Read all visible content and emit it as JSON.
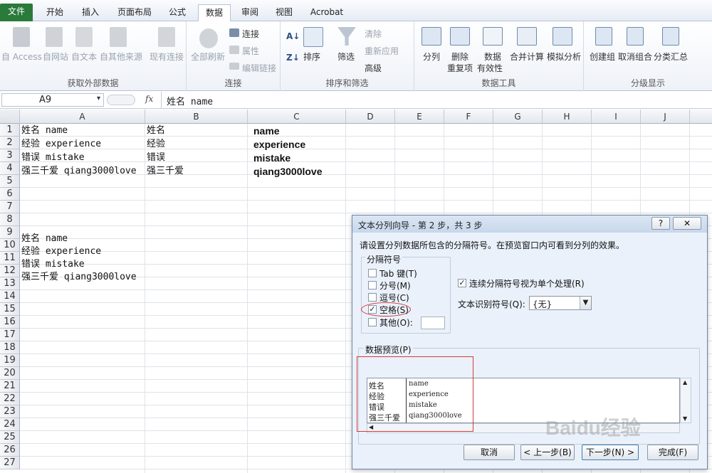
{
  "tabs": [
    "文件",
    "开始",
    "插入",
    "页面布局",
    "公式",
    "数据",
    "审阅",
    "视图",
    "Acrobat"
  ],
  "ribbon": {
    "external": {
      "label": "获取外部数据",
      "access": "自 Access",
      "web": "自网站",
      "text": "自文本",
      "other": "自其他来源",
      "existing": "现有连接"
    },
    "connections": {
      "label": "连接",
      "refresh_all": "全部刷新",
      "connections": "连接",
      "properties": "属性",
      "edit_links": "编辑链接"
    },
    "sort_filter": {
      "label": "排序和筛选",
      "sort": "排序",
      "filter": "筛选",
      "clear": "清除",
      "reapply": "重新应用",
      "advanced": "高级"
    },
    "data_tools": {
      "label": "数据工具",
      "text_to_columns": "分列",
      "remove_dup_1": "删除",
      "remove_dup_2": "重复项",
      "validation_1": "数据",
      "validation_2": "有效性",
      "consolidate": "合并计算",
      "what_if": "模拟分析"
    },
    "outline": {
      "label": "分级显示",
      "group": "创建组",
      "ungroup": "取消组合",
      "subtotal": "分类汇总"
    }
  },
  "formula_bar": {
    "name_box": "A9",
    "fx": "fx",
    "content": "姓名 name"
  },
  "sheet": {
    "columns": [
      "A",
      "B",
      "C",
      "D",
      "E",
      "F",
      "G",
      "H",
      "I",
      "J"
    ],
    "rows": [
      "1",
      "2",
      "3",
      "4",
      "5",
      "6",
      "7",
      "8",
      "9",
      "10",
      "11",
      "12",
      "13",
      "14",
      "15",
      "16",
      "17",
      "18",
      "19",
      "20",
      "21",
      "22",
      "23",
      "24",
      "25",
      "26",
      "27"
    ],
    "col_a": {
      "r1": "姓名 name",
      "r2": "经验 experience",
      "r3": "错误 mistake",
      "r4": "强三千爱 qiang3000love",
      "r9": "姓名 name",
      "r10": "经验 experience",
      "r11": "错误 mistake",
      "r12": "强三千爱 qiang3000love"
    },
    "col_b": {
      "r1": "姓名",
      "r2": "经验",
      "r3": "错误",
      "r4": "强三千爱"
    },
    "col_c": {
      "r1": "name",
      "r2": "experience",
      "r3": "mistake",
      "r4": "qiang3000love"
    }
  },
  "dialog": {
    "title": "文本分列向导 - 第 2 步，共 3 步",
    "help": "?",
    "instruction": "请设置分列数据所包含的分隔符号。在预览窗口内可看到分列的效果。",
    "delimiters_label": "分隔符号",
    "tab": "Tab 键(T)",
    "semicolon": "分号(M)",
    "comma": "逗号(C)",
    "space": "空格(S)",
    "other": "其他(O):",
    "consecutive": "连续分隔符号视为单个处理(R)",
    "qualifier_label": "文本识别符号(Q):",
    "qualifier_value": "{无}",
    "preview_label": "数据预览(P)",
    "preview_rows": [
      [
        "姓名",
        "name"
      ],
      [
        "经验",
        "experience"
      ],
      [
        "错误",
        "mistake"
      ],
      [
        "强三千爱",
        "qiang3000love"
      ]
    ],
    "cancel": "取消",
    "back": "< 上一步(B)",
    "next": "下一步(N) >",
    "finish": "完成(F)",
    "checked_mark": "✓"
  },
  "watermark": "Baidu经验"
}
